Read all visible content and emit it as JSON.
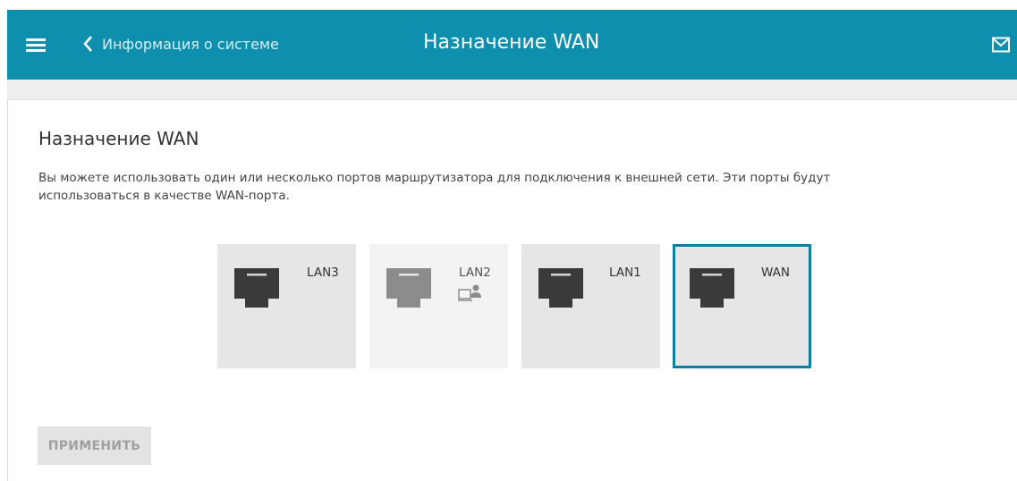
{
  "header": {
    "back_label": "Информация о системе",
    "title": "Назначение WAN"
  },
  "main": {
    "heading": "Назначение WAN",
    "description": "Вы можете использовать один или несколько портов маршрутизатора для подключения к внешней сети. Эти порты будут использоваться в качестве WAN-порта.",
    "ports": [
      {
        "label": "LAN3",
        "state": "available"
      },
      {
        "label": "LAN2",
        "state": "disabled",
        "badge_icon": "computer-user-icon"
      },
      {
        "label": "LAN1",
        "state": "available"
      },
      {
        "label": "WAN",
        "state": "selected"
      }
    ],
    "apply_label": "ПРИМЕНИТЬ"
  },
  "colors": {
    "topbar": "#0f8fae",
    "selected_border": "#0f7fa0",
    "port_bg": "#e6e6e6",
    "port_disabled_bg": "#f3f3f3"
  }
}
